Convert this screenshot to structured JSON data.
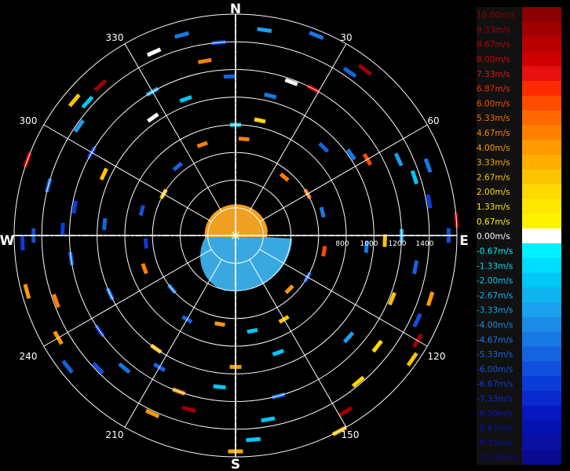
{
  "chart_data": {
    "type": "polar-radar-velocity",
    "cardinals": [
      "N",
      "E",
      "S",
      "W"
    ],
    "bearing_labels": [
      "30",
      "60",
      "120",
      "150",
      "210",
      "240",
      "300",
      "330"
    ],
    "range_labels": [
      "800",
      "1000",
      "1200",
      "1400"
    ],
    "range_max": 1600,
    "ring_step": 200,
    "grid": true,
    "legend_position": "right",
    "colorbar": {
      "labels": [
        "10.00m/s",
        "9.33m/s",
        "8.67m/s",
        "8.00m/s",
        "7.33m/s",
        "6.87m/s",
        "6.00m/s",
        "5.33m/s",
        "4.67m/s",
        "4.00m/s",
        "3.33m/s",
        "2.67m/s",
        "2.00m/s",
        "1.33m/s",
        "0.67m/s",
        "0.00m/s",
        "-0.67m/s",
        "-1.33m/s",
        "-2.00m/s",
        "-2.67m/s",
        "-3.33m/s",
        "-4.00m/s",
        "-4.67m/s",
        "-5.33m/s",
        "-6.00m/s",
        "-6.67m/s",
        "-7.33m/s",
        "-8.00m/s",
        "-8.67m/s",
        "-9.33m/s",
        "-10.00m/s"
      ],
      "colors": [
        "#8b0000",
        "#a00000",
        "#b80000",
        "#d00000",
        "#e81010",
        "#ff2a00",
        "#ff4a00",
        "#ff6a00",
        "#ff8000",
        "#ff9a00",
        "#ffae00",
        "#ffc400",
        "#ffd800",
        "#ffe800",
        "#fff200",
        "#ffffff",
        "#00f0ff",
        "#00dcff",
        "#00c8f8",
        "#10b4f0",
        "#1aa0ec",
        "#1a8ce8",
        "#1878e4",
        "#1464e0",
        "#1050dc",
        "#0c3cd8",
        "#0a2ad0",
        "#0818c0",
        "#0612b0",
        "#0a10a0",
        "#0a0a90"
      ]
    },
    "center_echo": {
      "approaching_color": "#f0a020",
      "receding_color": "#3aa8e0"
    },
    "echoes": [
      {
        "az": 8,
        "r": 1500,
        "c": "#1aa0ec"
      },
      {
        "az": 22,
        "r": 1560,
        "c": "#1878e4"
      },
      {
        "az": 35,
        "r": 1440,
        "c": "#1464e0"
      },
      {
        "az": 38,
        "r": 1520,
        "c": "#a00000"
      },
      {
        "az": 28,
        "r": 1200,
        "c": "#d00000"
      },
      {
        "az": 20,
        "r": 1180,
        "c": "#ffffff"
      },
      {
        "az": 14,
        "r": 1040,
        "c": "#1878e4"
      },
      {
        "az": 12,
        "r": 850,
        "c": "#ffd800"
      },
      {
        "az": 45,
        "r": 900,
        "c": "#1464e0"
      },
      {
        "az": 55,
        "r": 1020,
        "c": "#1878e4"
      },
      {
        "az": 60,
        "r": 1100,
        "c": "#ff4a00"
      },
      {
        "az": 65,
        "r": 1300,
        "c": "#1aa0ec"
      },
      {
        "az": 70,
        "r": 1480,
        "c": "#1878e4"
      },
      {
        "az": 72,
        "r": 1360,
        "c": "#00c8f8"
      },
      {
        "az": 80,
        "r": 1420,
        "c": "#0c3cd8"
      },
      {
        "az": 86,
        "r": 1600,
        "c": "#a00000"
      },
      {
        "az": 90,
        "r": 1540,
        "c": "#1050dc"
      },
      {
        "az": 90,
        "r": 1200,
        "c": "#1aa0ec"
      },
      {
        "az": 92,
        "r": 1080,
        "c": "#ffc400"
      },
      {
        "az": 95,
        "r": 950,
        "c": "#1878e4"
      },
      {
        "az": 100,
        "r": 1320,
        "c": "#1464e0"
      },
      {
        "az": 108,
        "r": 1480,
        "c": "#ff9a00"
      },
      {
        "az": 112,
        "r": 1220,
        "c": "#ffc400"
      },
      {
        "az": 115,
        "r": 1450,
        "c": "#1050dc"
      },
      {
        "az": 120,
        "r": 1520,
        "c": "#a00000"
      },
      {
        "az": 125,
        "r": 1560,
        "c": "#ffc400"
      },
      {
        "az": 128,
        "r": 1300,
        "c": "#ffd800"
      },
      {
        "az": 132,
        "r": 1100,
        "c": "#1aa0ec"
      },
      {
        "az": 140,
        "r": 1380,
        "c": "#ffd800"
      },
      {
        "az": 148,
        "r": 1500,
        "c": "#a00000"
      },
      {
        "az": 152,
        "r": 1600,
        "c": "#ffc400"
      },
      {
        "az": 160,
        "r": 900,
        "c": "#00c8f8"
      },
      {
        "az": 165,
        "r": 1200,
        "c": "#1464e0"
      },
      {
        "az": 170,
        "r": 1350,
        "c": "#00c8f8"
      },
      {
        "az": 175,
        "r": 1480,
        "c": "#00c8f8"
      },
      {
        "az": 180,
        "r": 1560,
        "c": "#ffae00"
      },
      {
        "az": 180,
        "r": 950,
        "c": "#ff9a00"
      },
      {
        "az": 186,
        "r": 1100,
        "c": "#00c8f8"
      },
      {
        "az": 195,
        "r": 1300,
        "c": "#a00000"
      },
      {
        "az": 200,
        "r": 1200,
        "c": "#ff9a00"
      },
      {
        "az": 205,
        "r": 1420,
        "c": "#ff9a00"
      },
      {
        "az": 210,
        "r": 1100,
        "c": "#1464e0"
      },
      {
        "az": 215,
        "r": 1000,
        "c": "#ffc400"
      },
      {
        "az": 220,
        "r": 1250,
        "c": "#1878e4"
      },
      {
        "az": 226,
        "r": 1380,
        "c": "#1050dc"
      },
      {
        "az": 232,
        "r": 1540,
        "c": "#1464e0"
      },
      {
        "az": 235,
        "r": 1200,
        "c": "#0c3cd8"
      },
      {
        "az": 240,
        "r": 1480,
        "c": "#ff9a00"
      },
      {
        "az": 245,
        "r": 1000,
        "c": "#1878e4"
      },
      {
        "az": 250,
        "r": 1380,
        "c": "#ff8000"
      },
      {
        "az": 255,
        "r": 1560,
        "c": "#ff9a00"
      },
      {
        "az": 262,
        "r": 1200,
        "c": "#1464e0"
      },
      {
        "az": 268,
        "r": 1540,
        "c": "#0c3cd8"
      },
      {
        "az": 270,
        "r": 1460,
        "c": "#1050dc"
      },
      {
        "az": 272,
        "r": 1250,
        "c": "#0c3cd8"
      },
      {
        "az": 275,
        "r": 950,
        "c": "#1464e0"
      },
      {
        "az": 280,
        "r": 1180,
        "c": "#0c3cd8"
      },
      {
        "az": 285,
        "r": 1400,
        "c": "#1464e0"
      },
      {
        "az": 290,
        "r": 1600,
        "c": "#d00000"
      },
      {
        "az": 295,
        "r": 1050,
        "c": "#ffc400"
      },
      {
        "az": 300,
        "r": 1200,
        "c": "#0c3cd8"
      },
      {
        "az": 305,
        "r": 1380,
        "c": "#1aa0ec"
      },
      {
        "az": 310,
        "r": 1520,
        "c": "#ffc400"
      },
      {
        "az": 312,
        "r": 1440,
        "c": "#00c8f8"
      },
      {
        "az": 318,
        "r": 1460,
        "c": "#a00000"
      },
      {
        "az": 325,
        "r": 1040,
        "c": "#ffffff"
      },
      {
        "az": 330,
        "r": 1200,
        "c": "#1aa0ec"
      },
      {
        "az": 336,
        "r": 1450,
        "c": "#ffffff"
      },
      {
        "az": 340,
        "r": 1050,
        "c": "#00c8f8"
      },
      {
        "az": 345,
        "r": 1500,
        "c": "#1878e4"
      },
      {
        "az": 350,
        "r": 1280,
        "c": "#ff8000"
      },
      {
        "az": 355,
        "r": 1400,
        "c": "#1050dc"
      },
      {
        "az": 358,
        "r": 1150,
        "c": "#1464e0"
      },
      {
        "az": 0,
        "r": 800,
        "c": "#00c8f8"
      },
      {
        "az": 5,
        "r": 700,
        "c": "#ff8000"
      },
      {
        "az": 40,
        "r": 550,
        "c": "#ff8000"
      },
      {
        "az": 60,
        "r": 600,
        "c": "#ff6a00"
      },
      {
        "az": 75,
        "r": 650,
        "c": "#1878e4"
      },
      {
        "az": 100,
        "r": 650,
        "c": "#ff4a00"
      },
      {
        "az": 120,
        "r": 600,
        "c": "#1050dc"
      },
      {
        "az": 135,
        "r": 550,
        "c": "#ff9a00"
      },
      {
        "az": 150,
        "r": 700,
        "c": "#ffc400"
      },
      {
        "az": 170,
        "r": 700,
        "c": "#00c8f8"
      },
      {
        "az": 190,
        "r": 650,
        "c": "#ff9a00"
      },
      {
        "az": 210,
        "r": 700,
        "c": "#1464e0"
      },
      {
        "az": 230,
        "r": 600,
        "c": "#1878e4"
      },
      {
        "az": 250,
        "r": 700,
        "c": "#ff8000"
      },
      {
        "az": 265,
        "r": 650,
        "c": "#0c3cd8"
      },
      {
        "az": 285,
        "r": 700,
        "c": "#1050dc"
      },
      {
        "az": 300,
        "r": 600,
        "c": "#ffc400"
      },
      {
        "az": 320,
        "r": 650,
        "c": "#1464e0"
      },
      {
        "az": 340,
        "r": 700,
        "c": "#ff8000"
      }
    ]
  }
}
